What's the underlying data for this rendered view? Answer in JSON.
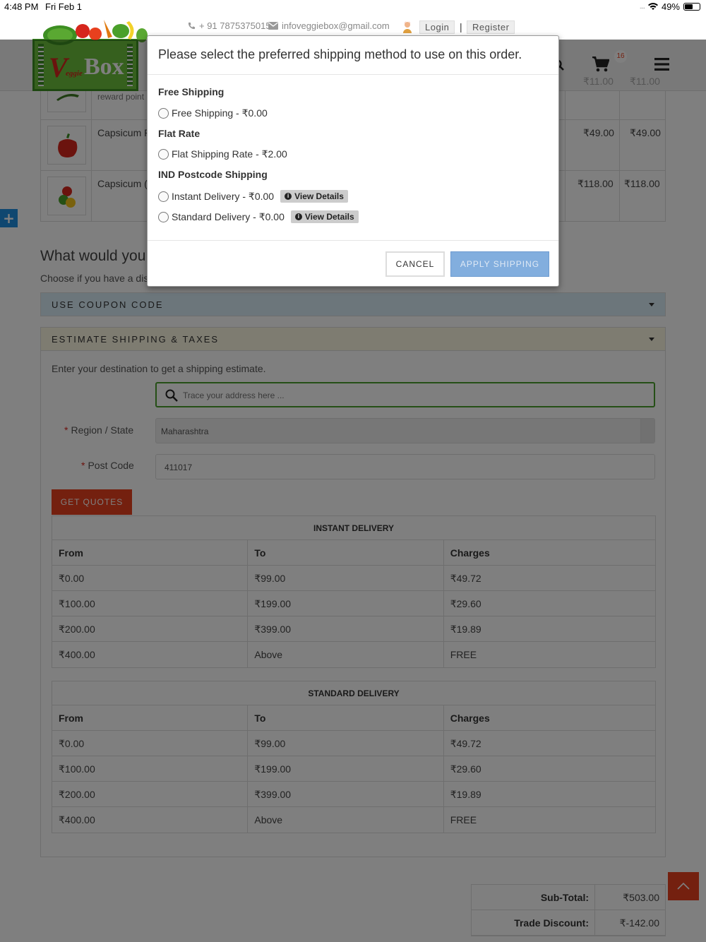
{
  "status_bar": {
    "time": "4:48 PM",
    "date": "Fri Feb 1",
    "battery": "49%"
  },
  "contact": {
    "phone": "+ 91 7875375015",
    "email": "infoveggiebox@gmail.com"
  },
  "auth": {
    "login": "Login",
    "separator": "|",
    "register": "Register"
  },
  "logo": {
    "v": "V",
    "small": "eggie",
    "box": "Box"
  },
  "cart": {
    "badge": "16",
    "partial_row": {
      "name_fragment": "reward point",
      "unit_price": "₹11.00",
      "total": "₹11.00"
    },
    "rows": [
      {
        "name": "Capsicum R",
        "unit_price": "₹49.00",
        "total": "₹49.00"
      },
      {
        "name": "Capsicum (",
        "unit_price": "₹118.00",
        "total": "₹118.00"
      }
    ]
  },
  "section": {
    "title": "What would you",
    "subtitle": "Choose if you have a dis"
  },
  "coupon_panel": {
    "title": "USE COUPON CODE"
  },
  "shipping_panel": {
    "title": "ESTIMATE SHIPPING & TAXES",
    "intro": "Enter your destination to get a shipping estimate.",
    "search_placeholder": "Trace your address here ...",
    "region_label": "Region / State",
    "region_value": "Maharashtra",
    "postcode_label": "Post Code",
    "postcode_value": "411017",
    "required_mark": "*",
    "get_quotes": "GET QUOTES"
  },
  "instant_table": {
    "caption": "INSTANT DELIVERY",
    "headers": [
      "From",
      "To",
      "Charges"
    ],
    "rows": [
      [
        "₹0.00",
        "₹99.00",
        "₹49.72"
      ],
      [
        "₹100.00",
        "₹199.00",
        "₹29.60"
      ],
      [
        "₹200.00",
        "₹399.00",
        "₹19.89"
      ],
      [
        "₹400.00",
        "Above",
        "FREE"
      ]
    ]
  },
  "standard_table": {
    "caption": "STANDARD DELIVERY",
    "headers": [
      "From",
      "To",
      "Charges"
    ],
    "rows": [
      [
        "₹0.00",
        "₹99.00",
        "₹49.72"
      ],
      [
        "₹100.00",
        "₹199.00",
        "₹29.60"
      ],
      [
        "₹200.00",
        "₹399.00",
        "₹19.89"
      ],
      [
        "₹400.00",
        "Above",
        "FREE"
      ]
    ]
  },
  "totals": [
    {
      "label": "Sub-Total:",
      "value": "₹503.00"
    },
    {
      "label": "Trade Discount:",
      "value": "₹-142.00"
    }
  ],
  "modal": {
    "title": "Please select the preferred shipping method to use on this order.",
    "groups": [
      {
        "name": "Free Shipping",
        "options": [
          {
            "label": "Free Shipping - ₹0.00"
          }
        ]
      },
      {
        "name": "Flat Rate",
        "options": [
          {
            "label": "Flat Shipping Rate - ₹2.00"
          }
        ]
      },
      {
        "name": "IND Postcode Shipping",
        "options": [
          {
            "label": "Instant Delivery - ₹0.00",
            "details": "View Details"
          },
          {
            "label": "Standard Delivery - ₹0.00",
            "details": "View Details"
          }
        ]
      }
    ],
    "cancel": "CANCEL",
    "apply": "APPLY SHIPPING"
  },
  "icons": {
    "phone": "phone-icon",
    "mail": "mail-icon",
    "user": "user-avatar-icon",
    "cart": "cart-icon",
    "menu": "hamburger-menu-icon",
    "search": "search-icon",
    "plus": "plus-icon",
    "up": "chevron-up-icon",
    "info": "info-icon"
  },
  "colors": {
    "accent": "#e8401e",
    "brand_green": "#6dc13c",
    "coupon_bg": "#d9edf7",
    "shipping_bg": "#fcf8e3",
    "apply_button": "#82aede",
    "plus_button": "#1e8fe0"
  }
}
